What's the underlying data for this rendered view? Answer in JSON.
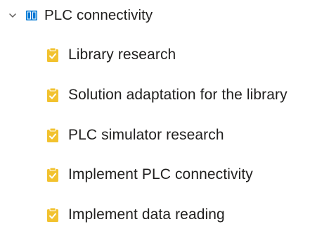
{
  "tree": {
    "parent": {
      "label": "PLC connectivity",
      "expanded": true,
      "toggle_icon": "chevron-down-icon",
      "item_icon": "book-icon",
      "icon_color": "#0078d4"
    },
    "children": [
      {
        "label": "Library research",
        "item_icon": "clipboard-task-icon"
      },
      {
        "label": "Solution adaptation for the library",
        "item_icon": "clipboard-task-icon"
      },
      {
        "label": "PLC simulator research",
        "item_icon": "clipboard-task-icon"
      },
      {
        "label": "Implement PLC connectivity",
        "item_icon": "clipboard-task-icon"
      },
      {
        "label": "Implement data reading",
        "item_icon": "clipboard-task-icon"
      }
    ],
    "task_icon_color": "#f2c22f"
  }
}
